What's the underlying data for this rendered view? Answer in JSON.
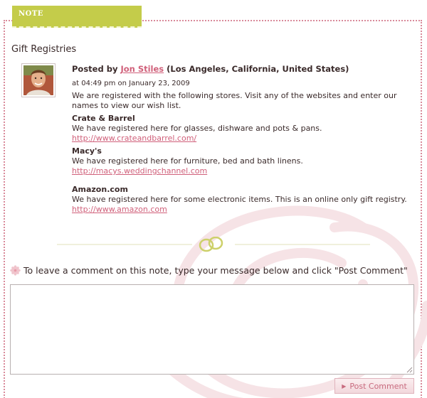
{
  "note_tab": {
    "label": "NOTE"
  },
  "note": {
    "title": "Gift Registries",
    "posted_by_prefix": "Posted by",
    "author": "Jon Stiles",
    "location": "(Los Angeles, California, United States)",
    "timestamp": "at 04:49 pm on January 23, 2009",
    "intro": "We are registered with the following stores. Visit any of the websites and enter our names to view our wish list.",
    "stores": [
      {
        "name": "Crate & Barrel",
        "description": "We have registered here for glasses, dishware and pots & pans.",
        "url": "http://www.crateandbarrel.com/"
      },
      {
        "name": "Macy's",
        "description": "We have registered here for furniture, bed and bath linens.",
        "url": "http://macys.weddingchannel.com"
      },
      {
        "name": "Amazon.com",
        "description": "We have registered here for some electronic items. This is an online only gift registry.",
        "url": "http://www.amazon.com"
      }
    ]
  },
  "comment": {
    "prompt": "To leave a comment on this note, type your message below and click \"Post Comment\"",
    "value": "",
    "button_label": "Post Comment"
  },
  "colors": {
    "tab_green": "#c4cc4a",
    "link_pink": "#d0607a",
    "border_pink": "#d98a9a",
    "rings_green": "#cdd06a"
  }
}
